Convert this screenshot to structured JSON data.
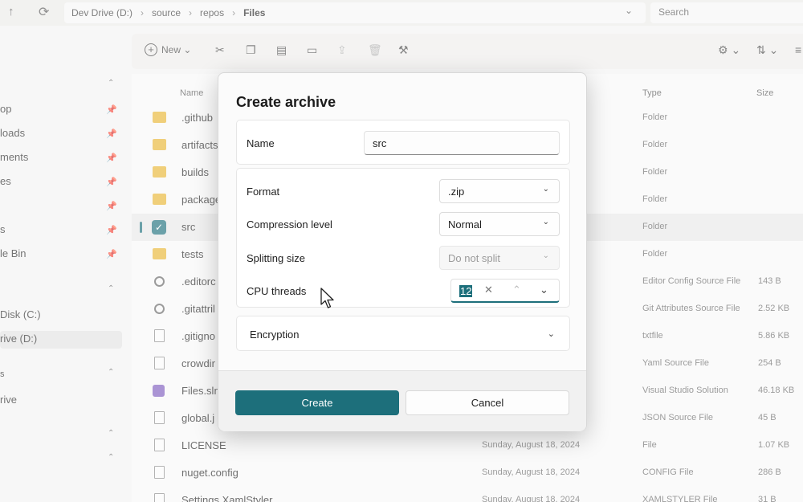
{
  "address": {
    "crumbs": [
      "Dev Drive (D:)",
      "source",
      "repos",
      "Files"
    ],
    "search_placeholder": "Search"
  },
  "toolbar": {
    "new_label": "New"
  },
  "sidebar": {
    "items": [
      {
        "label": "op"
      },
      {
        "label": "loads"
      },
      {
        "label": "ments"
      },
      {
        "label": "es"
      },
      {
        "label": ""
      },
      {
        "label": "s"
      },
      {
        "label": "le Bin"
      },
      {
        "label": "Disk (C:)"
      },
      {
        "label": "rive (D:)"
      },
      {
        "label": "s"
      },
      {
        "label": "rive"
      }
    ]
  },
  "file_list": {
    "columns": {
      "name": "Name",
      "type": "Type",
      "size": "Size"
    },
    "rows": [
      {
        "name": ".github",
        "date": "",
        "type": "Folder",
        "size": ""
      },
      {
        "name": "artifacts",
        "date": "",
        "type": "Folder",
        "size": ""
      },
      {
        "name": "builds",
        "date": "",
        "type": "Folder",
        "size": ""
      },
      {
        "name": "package",
        "date": "",
        "type": "Folder",
        "size": ""
      },
      {
        "name": "src",
        "date": "",
        "type": "Folder",
        "size": ""
      },
      {
        "name": "tests",
        "date": "",
        "type": "Folder",
        "size": ""
      },
      {
        "name": ".editorc",
        "date": "",
        "type": "Editor Config Source File",
        "size": "143 B"
      },
      {
        "name": ".gitattril",
        "date": "",
        "type": "Git Attributes Source File",
        "size": "2.52 KB"
      },
      {
        "name": ".gitigno",
        "date": "",
        "type": "txtfile",
        "size": "5.86 KB"
      },
      {
        "name": "crowdir",
        "date": "",
        "type": "Yaml Source File",
        "size": "254 B"
      },
      {
        "name": "Files.sln",
        "date": "",
        "type": "Visual Studio Solution",
        "size": "46.18 KB"
      },
      {
        "name": "global.j",
        "date": "",
        "type": "JSON Source File",
        "size": "45 B"
      },
      {
        "name": "LICENSE",
        "date": "Sunday, August 18, 2024",
        "type": "File",
        "size": "1.07 KB"
      },
      {
        "name": "nuget.config",
        "date": "Sunday, August 18, 2024",
        "type": "CONFIG File",
        "size": "286 B"
      },
      {
        "name": "Settings.XamlStyler",
        "date": "Sunday, August 18, 2024",
        "type": "XAMLSTYLER File",
        "size": "31 B"
      }
    ]
  },
  "dialog": {
    "title": "Create archive",
    "name_label": "Name",
    "name_value": "src",
    "format_label": "Format",
    "format_value": ".zip",
    "compression_label": "Compression level",
    "compression_value": "Normal",
    "splitting_label": "Splitting size",
    "splitting_value": "Do not split",
    "cpu_label": "CPU threads",
    "cpu_value": "12",
    "encryption_label": "Encryption",
    "create_label": "Create",
    "cancel_label": "Cancel",
    "accent_color": "#1d6f7b"
  }
}
